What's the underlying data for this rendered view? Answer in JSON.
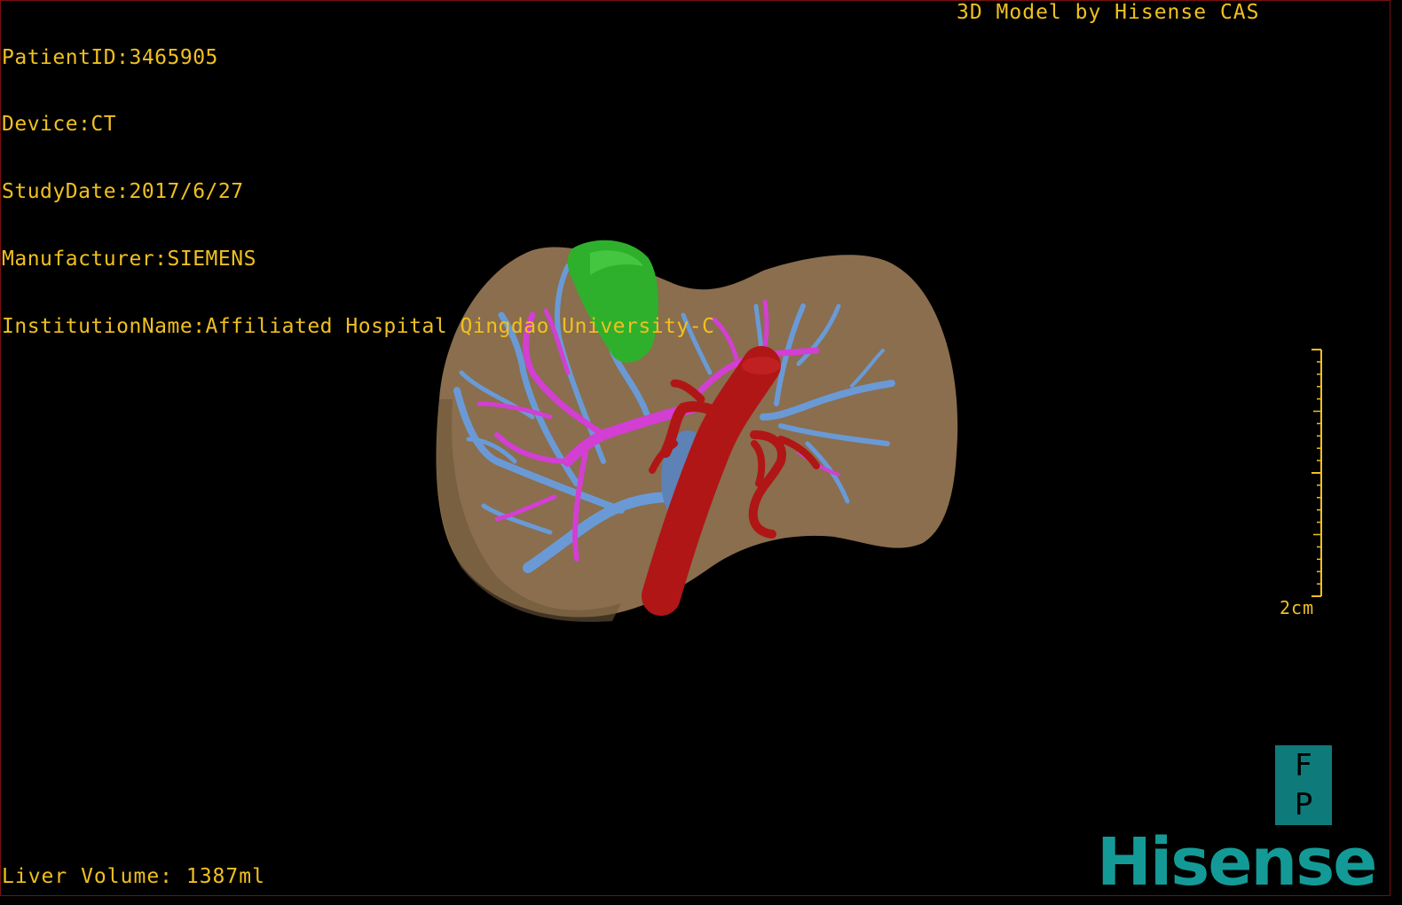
{
  "header": {
    "patient_id": "PatientID:3465905",
    "device": "Device:CT",
    "study_date": "StudyDate:2017/6/27",
    "manufacturer": "Manufacturer:SIEMENS",
    "institution": "InstitutionName:Affiliated Hospital Qingdao University-C"
  },
  "brand_top": "3D Model by Hisense CAS",
  "footer": {
    "liver_volume": "Liver Volume: 1387ml"
  },
  "scale_bar": {
    "label": "2cm"
  },
  "orientation_cube": {
    "top": "F",
    "bottom": "P"
  },
  "logo": "Hisense",
  "colors": {
    "overlay_text": "#f0c020",
    "liver": "#8a6e4e",
    "gallbladder": "#2fb02c",
    "portal_vein": "#6a9ad6",
    "hepatic_vein": "#d23fd2",
    "artery": "#b01616",
    "brand": "#149a96"
  }
}
